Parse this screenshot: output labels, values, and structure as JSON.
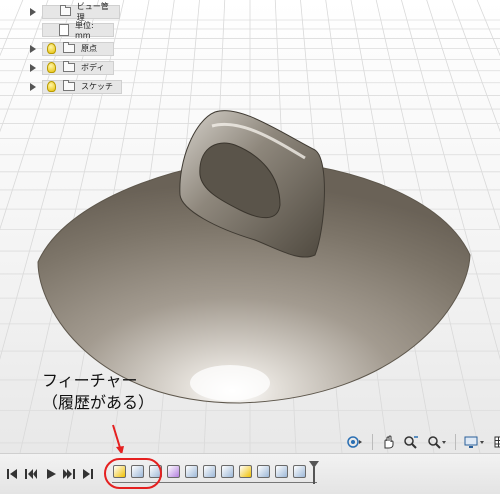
{
  "browser": {
    "items": [
      {
        "label": "ビュー管理",
        "icon": "folder-icon"
      },
      {
        "label": "単位: mm",
        "icon": "document-icon"
      },
      {
        "label": "原点",
        "icon": "folder-icon"
      },
      {
        "label": "ボディ",
        "icon": "folder-icon"
      },
      {
        "label": "スケッチ",
        "icon": "folder-icon"
      }
    ]
  },
  "annotation": {
    "line1": "フィーチャー",
    "line2": "（履歴がある）",
    "color": "#e52020"
  },
  "nav_toolbar": {
    "icons": [
      "orbit-icon",
      "pan-icon",
      "zoom-icon",
      "zoom-window-icon",
      "display-settings-icon",
      "grid-icon"
    ]
  },
  "timeline": {
    "controls": [
      "go-to-start-icon",
      "step-back-icon",
      "play-icon",
      "step-forward-icon",
      "go-to-end-icon"
    ],
    "features": [
      {
        "name": "sketch-feature-icon",
        "color": "#f0c000"
      },
      {
        "name": "extrude-feature-icon",
        "color": "#9db8d8"
      },
      {
        "name": "shell-feature-icon",
        "color": "#9db8d8"
      },
      {
        "name": "form-feature-icon",
        "color": "#b480e0"
      },
      {
        "name": "body-feature-icon",
        "color": "#9db8d8"
      },
      {
        "name": "move-feature-icon",
        "color": "#9db8d8"
      },
      {
        "name": "plane-feature-icon",
        "color": "#9db8d8"
      },
      {
        "name": "sketch-feature-icon",
        "color": "#f0c000"
      },
      {
        "name": "combine-feature-icon",
        "color": "#9db8d8"
      },
      {
        "name": "fillet-feature-icon",
        "color": "#9db8d8"
      },
      {
        "name": "fillet-feature-icon",
        "color": "#9db8d8"
      }
    ]
  }
}
